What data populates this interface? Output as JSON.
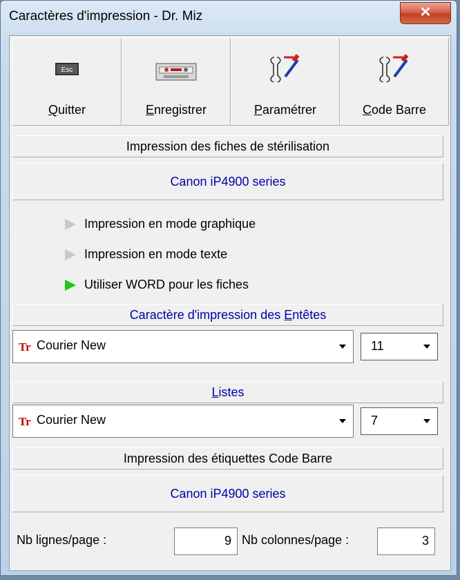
{
  "window": {
    "title": "Caractères d'impression - Dr. Miz"
  },
  "toolbar": [
    {
      "label": "Quitter",
      "ul": "Q",
      "rest": "uitter",
      "icon": "esc-key-icon"
    },
    {
      "label": "Enregistrer",
      "ul": "E",
      "rest": "nregistrer",
      "icon": "cassette-icon"
    },
    {
      "label": "Paramétrer",
      "ul": "P",
      "rest": "aramétrer",
      "icon": "tools-icon"
    },
    {
      "label": "Code Barre",
      "ul": "C",
      "rest": "ode Barre",
      "icon": "tools-icon"
    }
  ],
  "sections": {
    "fiches_title": "Impression des fiches de stérilisation",
    "fiches_printer": "Canon iP4900 series",
    "options": [
      {
        "label": "Impression en mode graphique",
        "active": false
      },
      {
        "label": "Impression en mode texte",
        "active": false
      },
      {
        "label": "Utiliser WORD pour les fiches",
        "active": true
      }
    ],
    "entetes_pre": "Caractère d'impression des ",
    "entetes_ul": "E",
    "entetes_post": "ntêtes",
    "entetes_font": "Courier New",
    "entetes_size": "11",
    "listes_ul": "L",
    "listes_rest": "istes",
    "listes_font": "Courier New",
    "listes_size": "7",
    "etiquettes_title": "Impression des étiquettes Code Barre",
    "etiquettes_printer": "Canon iP4900 series"
  },
  "bottom": {
    "lines_label": "Nb lignes/page :",
    "lines_value": "9",
    "cols_label": "Nb colonnes/page :",
    "cols_value": "3"
  },
  "icons": {
    "font_icon": "Tr"
  },
  "colors": {
    "printer_text": "#0000a8",
    "active_arrow": "#22c41f",
    "close_button": "#c2401f"
  }
}
